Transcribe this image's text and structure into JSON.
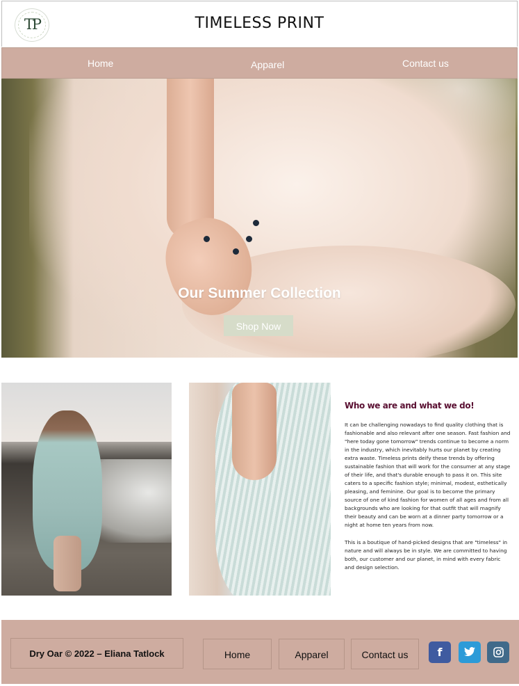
{
  "header": {
    "logo_text": "TP",
    "site_title": "TIMELESS PRINT"
  },
  "nav": {
    "items": [
      {
        "label": "Home"
      },
      {
        "label": "Apparel"
      },
      {
        "label": "Contact us"
      }
    ]
  },
  "hero": {
    "title": "Our Summer Collection",
    "button_label": "Shop Now",
    "button_color": "#d6dcc9"
  },
  "about": {
    "title": "Who we are and what we do!",
    "title_color": "#5a1032",
    "paragraph1": "It can be challenging nowadays to find quality clothing that is fashionable and also relevant after one season. Fast fashion and \"here today gone tomorrow\" trends continue to become a norm in the industry, which inevitably hurts our planet by creating extra waste. Timeless prints deify these trends by offering sustainable fashion that will work for the consumer at any stage of their life, and that's durable enough to pass it on. This site caters to a specific fashion style; minimal, modest, esthetically pleasing, and feminine. Our goal is to become the primary source of one of kind fashion for women of all ages and from all backgrounds who are looking for that outfit that will magnify their beauty and can be worn at a dinner party tomorrow or a night at home ten years from now.",
    "paragraph2": "This is a boutique of hand-picked designs that are \"timeless\" in nature and will always be in style. We are committed to having both, our customer and our planet, in mind with every fabric and design selection."
  },
  "footer": {
    "copyright": "Dry Oar © 2022 – Eliana Tatlock",
    "links": [
      {
        "label": "Home"
      },
      {
        "label": "Apparel"
      },
      {
        "label": "Contact us"
      }
    ],
    "social": [
      {
        "icon": "facebook-icon",
        "glyph": "f",
        "color": "#3f5ba0"
      },
      {
        "icon": "twitter-icon",
        "glyph": "🐦",
        "color": "#2c9bd8"
      },
      {
        "icon": "instagram-icon",
        "glyph": "◎",
        "color": "#406a8a"
      }
    ]
  },
  "colors": {
    "nav_bg": "#ceaca0",
    "footer_bg": "#ceaca0"
  }
}
